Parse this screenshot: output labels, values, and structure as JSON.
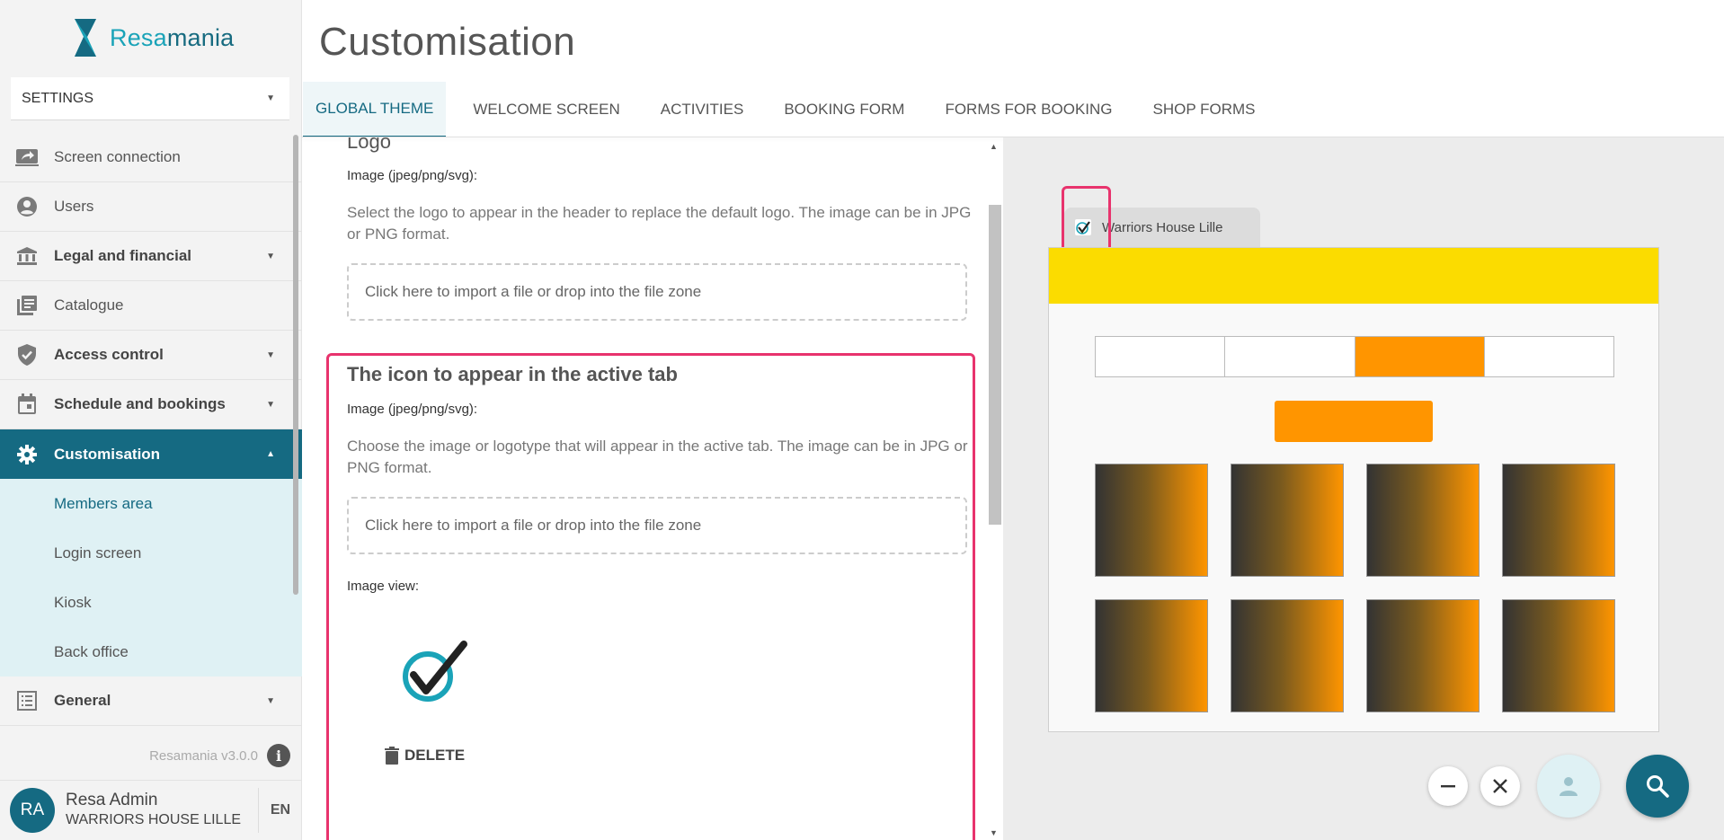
{
  "app": {
    "logo_text_a": "Resa",
    "logo_text_b": "mania",
    "section_select": "SETTINGS",
    "version": "Resamania v3.0.0"
  },
  "sidebar": {
    "items": [
      {
        "label": "Screen connection"
      },
      {
        "label": "Users"
      },
      {
        "label": "Legal and financial"
      },
      {
        "label": "Catalogue"
      },
      {
        "label": "Access control"
      },
      {
        "label": "Schedule and bookings"
      },
      {
        "label": "Customisation"
      },
      {
        "label": "General"
      }
    ],
    "submenu": [
      {
        "label": "Members area"
      },
      {
        "label": "Login screen"
      },
      {
        "label": "Kiosk"
      },
      {
        "label": "Back office"
      }
    ]
  },
  "user": {
    "initials": "RA",
    "name": "Resa Admin",
    "club": "WARRIORS HOUSE LILLE",
    "language": "EN"
  },
  "page": {
    "title": "Customisation",
    "tabs": [
      {
        "label": "GLOBAL THEME"
      },
      {
        "label": "WELCOME SCREEN"
      },
      {
        "label": "ACTIVITIES"
      },
      {
        "label": "BOOKING FORM"
      },
      {
        "label": "FORMS FOR BOOKING"
      },
      {
        "label": "SHOP FORMS"
      }
    ]
  },
  "form": {
    "logo": {
      "title": "Logo",
      "image_label": "Image (jpeg/png/svg):",
      "help": "Select the logo to appear in the header to replace the default logo. The image can be in JPG or PNG format.",
      "dropzone": "Click here to import a file or drop into the file zone"
    },
    "active_tab_icon": {
      "title": "The icon to appear in the active tab",
      "image_label": "Image (jpeg/png/svg):",
      "help": "Choose the image or logotype that will appear in the active tab. The image can be in JPG or PNG format.",
      "dropzone": "Click here to import a file or drop into the file zone",
      "view_label": "Image view:",
      "delete_label": "DELETE"
    }
  },
  "preview": {
    "tab_label": "Warriors House Lille",
    "colors": {
      "banner": "#fbdc00",
      "accent": "#ff9500",
      "brand": "#156a82",
      "highlight": "#e8336d"
    },
    "active_segment_index": 2
  }
}
